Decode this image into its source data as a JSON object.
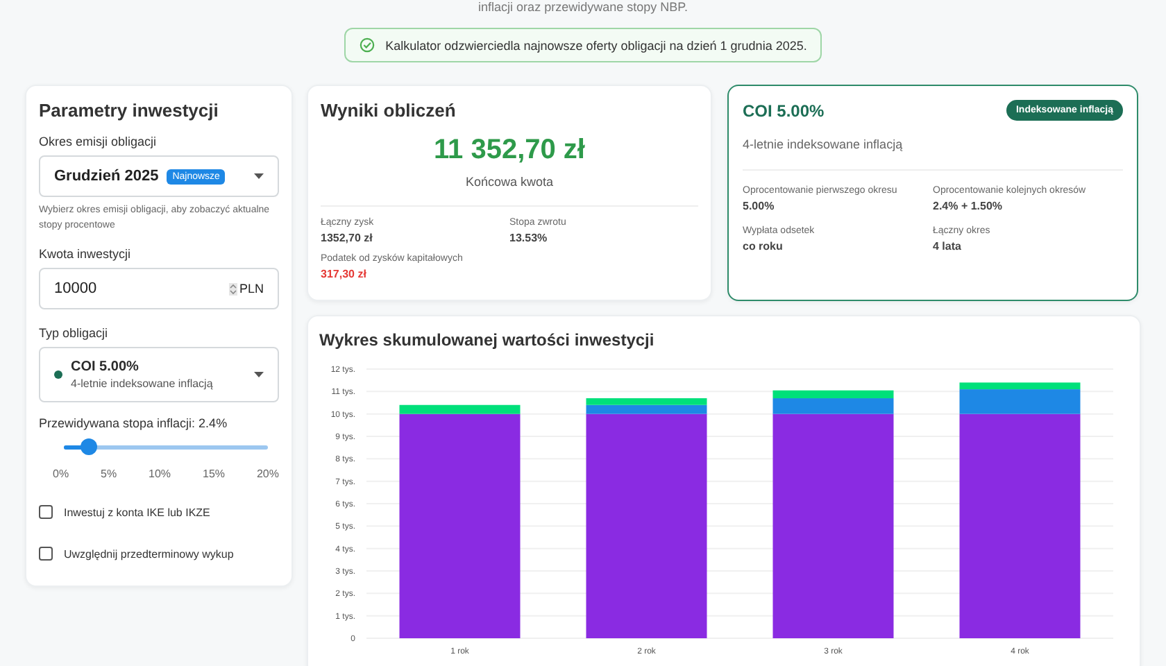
{
  "intro_tail": "inflacji oraz przewidywane stopy NBP.",
  "notice": {
    "text": "Kalkulator odzwierciedla najnowsze oferty obligacji na dzień 1 grudnia 2025."
  },
  "parameters": {
    "title": "Parametry inwestycji",
    "emission": {
      "label": "Okres emisji obligacji",
      "value": "Grudzień 2025",
      "badge": "Najnowsze",
      "help": "Wybierz okres emisji obligacji, aby zobaczyć aktualne stopy procentowe"
    },
    "amount": {
      "label": "Kwota inwestycji",
      "value": "10000",
      "unit": "PLN"
    },
    "bond_type": {
      "label": "Typ obligacji",
      "value": "COI 5.00%",
      "description": "4-letnie indeksowane inflacją"
    },
    "inflation": {
      "label": "Przewidywana stopa inflacji: 2.4%",
      "level": 0.12,
      "ticks": [
        "0%",
        "5%",
        "10%",
        "15%",
        "20%"
      ]
    },
    "options": [
      {
        "label": "Inwestuj z konta IKE lub IKZE",
        "checked": false
      },
      {
        "label": "Uwzględnij przedterminowy wykup",
        "checked": false
      }
    ]
  },
  "results": {
    "title": "Wyniki obliczeń",
    "final_amount": "11 352,70 zł",
    "final_label": "Końcowa kwota",
    "stats": [
      {
        "label": "Łączny zysk",
        "value": "1352,70 zł",
        "kind": "normal"
      },
      {
        "label": "Stopa zwrotu",
        "value": "13.53%",
        "kind": "normal"
      },
      {
        "label": "Podatek od zysków kapitałowych",
        "value": "317,30 zł",
        "kind": "negative"
      }
    ]
  },
  "bond": {
    "title": "COI 5.00%",
    "tag": "Indeksowane inflacją",
    "subtitle": "4-letnie indeksowane inflacją",
    "details": [
      {
        "label": "Oprocentowanie pierwszego okresu",
        "value": "5.00%"
      },
      {
        "label": "Oprocentowanie kolejnych okresów",
        "value": "2.4% + 1.50%"
      },
      {
        "label": "Wypłata odsetek",
        "value": "co roku"
      },
      {
        "label": "Łączny okres",
        "value": "4 lata"
      }
    ]
  },
  "chart": {
    "title": "Wykres skumulowanej wartości inwestycji",
    "chart_data": {
      "type": "bar",
      "stacked": true,
      "categories": [
        "1 rok",
        "2 rok",
        "3 rok",
        "4 rok"
      ],
      "series": [
        {
          "color": "#8a2be2",
          "values": [
            10,
            10,
            10,
            10
          ]
        },
        {
          "color": "#1e88e5",
          "values": [
            0,
            0.4,
            0.7,
            1.1
          ]
        },
        {
          "color": "#00e07a",
          "values": [
            0.4,
            0.3,
            0.35,
            0.3
          ]
        }
      ],
      "ylim": [
        0,
        12
      ],
      "grid": true,
      "yticks": [
        {
          "value": 0,
          "label": "0"
        },
        {
          "value": 1,
          "label": "1 tys."
        },
        {
          "value": 2,
          "label": "2 tys."
        },
        {
          "value": 3,
          "label": "3 tys."
        },
        {
          "value": 4,
          "label": "4 tys."
        },
        {
          "value": 5,
          "label": "5 tys."
        },
        {
          "value": 6,
          "label": "6 tys."
        },
        {
          "value": 7,
          "label": "7 tys."
        },
        {
          "value": 8,
          "label": "8 tys."
        },
        {
          "value": 9,
          "label": "9 tys."
        },
        {
          "value": 10,
          "label": "10 tys."
        },
        {
          "value": 11,
          "label": "11 tys."
        },
        {
          "value": 12,
          "label": "12 tys."
        }
      ]
    }
  }
}
